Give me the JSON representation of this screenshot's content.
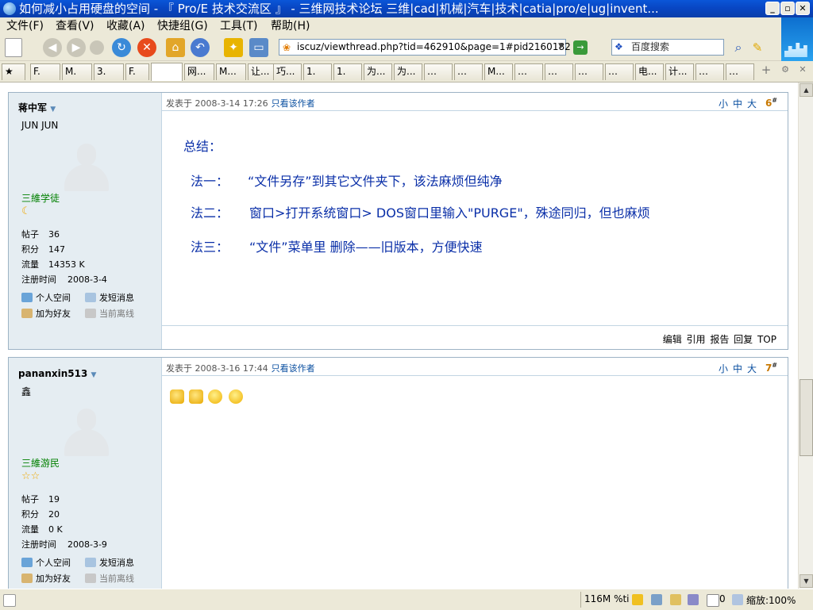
{
  "window": {
    "title": "如何减小占用硬盘的空间 - 『 Pro/E 技术交流区 』 - 三维网技术论坛 三维|cad|机械|汽车|技术|catia|pro/e|ug|invent..."
  },
  "menu": [
    "文件(F)",
    "查看(V)",
    "收藏(A)",
    "快捷组(G)",
    "工具(T)",
    "帮助(H)"
  ],
  "address": {
    "url": "iscuz/viewthread.php?tid=462910&page=1#pid2160182"
  },
  "search": {
    "placeholder": "百度搜索"
  },
  "tabs": [
    "F.",
    "M.",
    "3.",
    "F.",
    "",
    "网...",
    "M...",
    "让...",
    "巧...",
    "1.",
    "1.",
    "为...",
    "为...",
    "…",
    "…",
    "M...",
    "…",
    "…",
    "…",
    "…",
    "电...",
    "计...",
    "…",
    "…"
  ],
  "posts": [
    {
      "username": "蒋中军",
      "user_title": "JUN JUN",
      "rank": "三維学徒",
      "rank_icon": "moon-icon",
      "stats": {
        "posts_label": "帖子",
        "posts": "36",
        "credits_label": "积分",
        "credits": "147",
        "traffic_label": "流量",
        "traffic": "14353 K",
        "reg_label": "注册时间",
        "reg": "2008-3-4"
      },
      "links": {
        "space": "个人空间",
        "message": "发短消息",
        "friend": "加为好友",
        "online": "当前离线"
      },
      "date": "发表于  2008-3-14 17:26",
      "author_only": "只看该作者",
      "sizes": "小中大",
      "floor": "6",
      "content": {
        "heading": "总结：",
        "line1_label": "法一：",
        "line1": "“文件另存”到其它文件夹下，该法麻烦但纯净",
        "line2_label": "法二：",
        "line2a": "窗口>打开系统窗口> DOS窗口里输入\"PURGE\"，殊途同归，但也麻烦",
        "line3_label": "法三：",
        "line3": "“文件”菜单里  删除——旧版本，方便快速"
      },
      "actions": "编辑 引用 报告 回复 TOP"
    },
    {
      "username": "pananxin513",
      "user_title": "鑫",
      "rank": "三維游民",
      "rank_icon": "star-icon",
      "stats": {
        "posts_label": "帖子",
        "posts": "19",
        "credits_label": "积分",
        "credits": "20",
        "traffic_label": "流量",
        "traffic": "0 K",
        "reg_label": "注册时间",
        "reg": "2008-3-9"
      },
      "links": {
        "space": "个人空间",
        "message": "发短消息",
        "friend": "加为好友",
        "online": "当前离线"
      },
      "date": "发表于  2008-3-16 17:44",
      "author_only": "只看该作者",
      "sizes": "小中大",
      "floor": "7"
    }
  ],
  "status": {
    "memory": "116M %ti",
    "popups": "0",
    "zoom": "缩放:100%"
  },
  "colors": {
    "titlebar": "#0846c3",
    "post_text": "#0a2fa8",
    "rank": "#008000",
    "sidebar": "#e5edf2"
  }
}
